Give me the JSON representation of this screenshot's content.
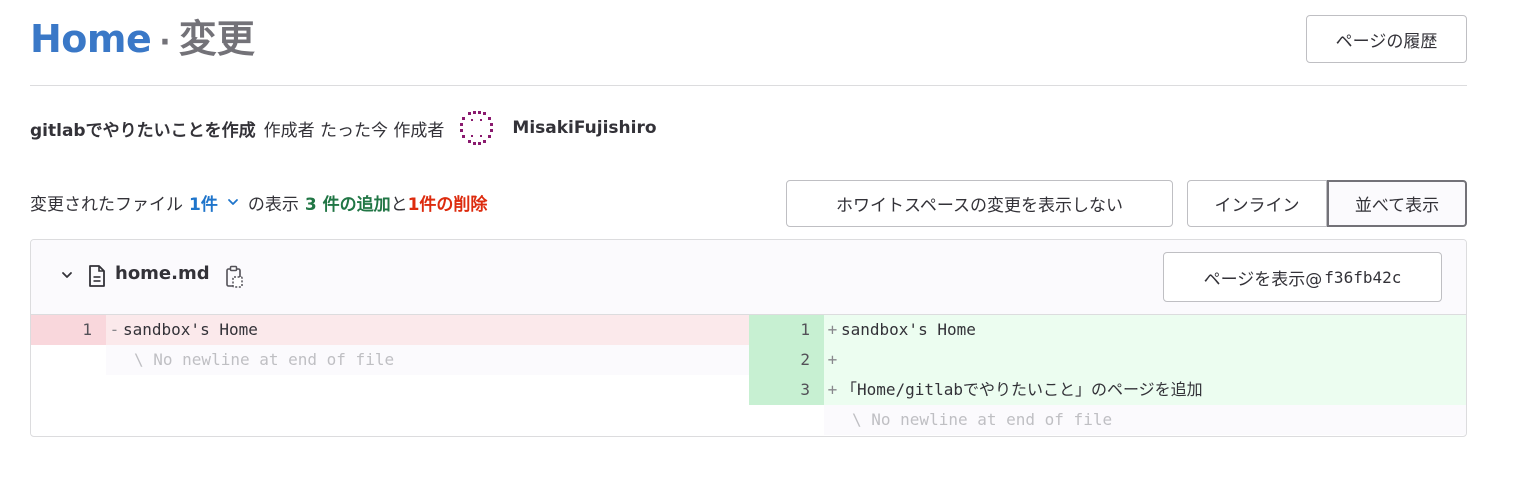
{
  "header": {
    "title": "Home",
    "separator": "·",
    "suffix": "変更",
    "history_button": "ページの履歴"
  },
  "commit": {
    "title": "gitlabでやりたいことを作成",
    "meta": "作成者 たった今 作成者",
    "author": "MisakiFujishiro",
    "avatar_color": "#8a1a6e"
  },
  "summary": {
    "prefix": "変更されたファイル",
    "files_count": "1件",
    "middle": "の表示",
    "additions": "3 件の追加",
    "conjunction": "と",
    "deletions": "1件の削除"
  },
  "toolbar": {
    "whitespace_button": "ホワイトスペースの変更を表示しない",
    "inline_button": "インライン",
    "parallel_button": "並べて表示"
  },
  "file": {
    "name": "home.md",
    "view_button_label": "ページを表示@",
    "view_button_sha": "f36fb42c"
  },
  "diff": {
    "left": [
      {
        "type": "old",
        "num": "1",
        "marker": "-",
        "text": "sandbox's Home"
      },
      {
        "type": "meta",
        "num": "",
        "marker": "",
        "text": "\\ No newline at end of file"
      },
      {
        "type": "empty",
        "num": "",
        "marker": "",
        "text": ""
      },
      {
        "type": "empty",
        "num": "",
        "marker": "",
        "text": ""
      }
    ],
    "right": [
      {
        "type": "new",
        "num": "1",
        "marker": "+",
        "text": "sandbox's Home"
      },
      {
        "type": "new",
        "num": "2",
        "marker": "+",
        "text": ""
      },
      {
        "type": "new",
        "num": "3",
        "marker": "+",
        "text": "「Home/gitlabでやりたいこと」のページを追加"
      },
      {
        "type": "meta",
        "num": "",
        "marker": "",
        "text": "\\ No newline at end of file"
      }
    ]
  }
}
